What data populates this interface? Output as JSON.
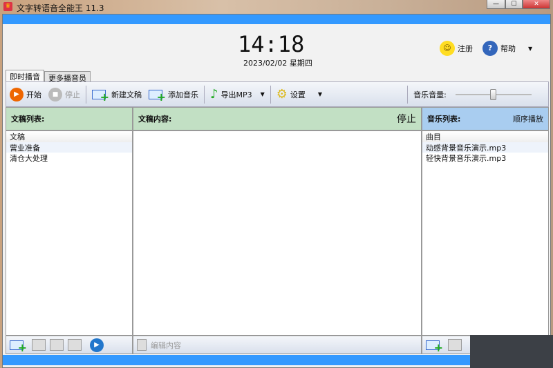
{
  "window": {
    "title": "文字转语音全能王 11.3",
    "app_icon": "crown-icon"
  },
  "header": {
    "time": "14:18",
    "date": "2023/02/02 星期四",
    "register_label": "注册",
    "help_label": "帮助"
  },
  "tabs": [
    {
      "label": "即时播音"
    },
    {
      "label": "更多播音员"
    }
  ],
  "toolbar": {
    "start": "开始",
    "stop": "停止",
    "new_doc": "新建文稿",
    "add_music": "添加音乐",
    "export": "导出MP3",
    "settings": "设置",
    "volume_label": "音乐音量:",
    "volume_level": 0.5
  },
  "docs": {
    "title": "文稿列表:",
    "column": "文稿",
    "items": [
      "营业准备",
      "清仓大处理"
    ]
  },
  "content": {
    "title": "文稿内容:",
    "status": "停止",
    "edit_label": "编辑内容"
  },
  "music": {
    "title": "音乐列表:",
    "mode": "顺序播放",
    "column": "曲目",
    "items": [
      "动感背景音乐演示.mp3",
      "轻快背景音乐演示.mp3"
    ]
  }
}
